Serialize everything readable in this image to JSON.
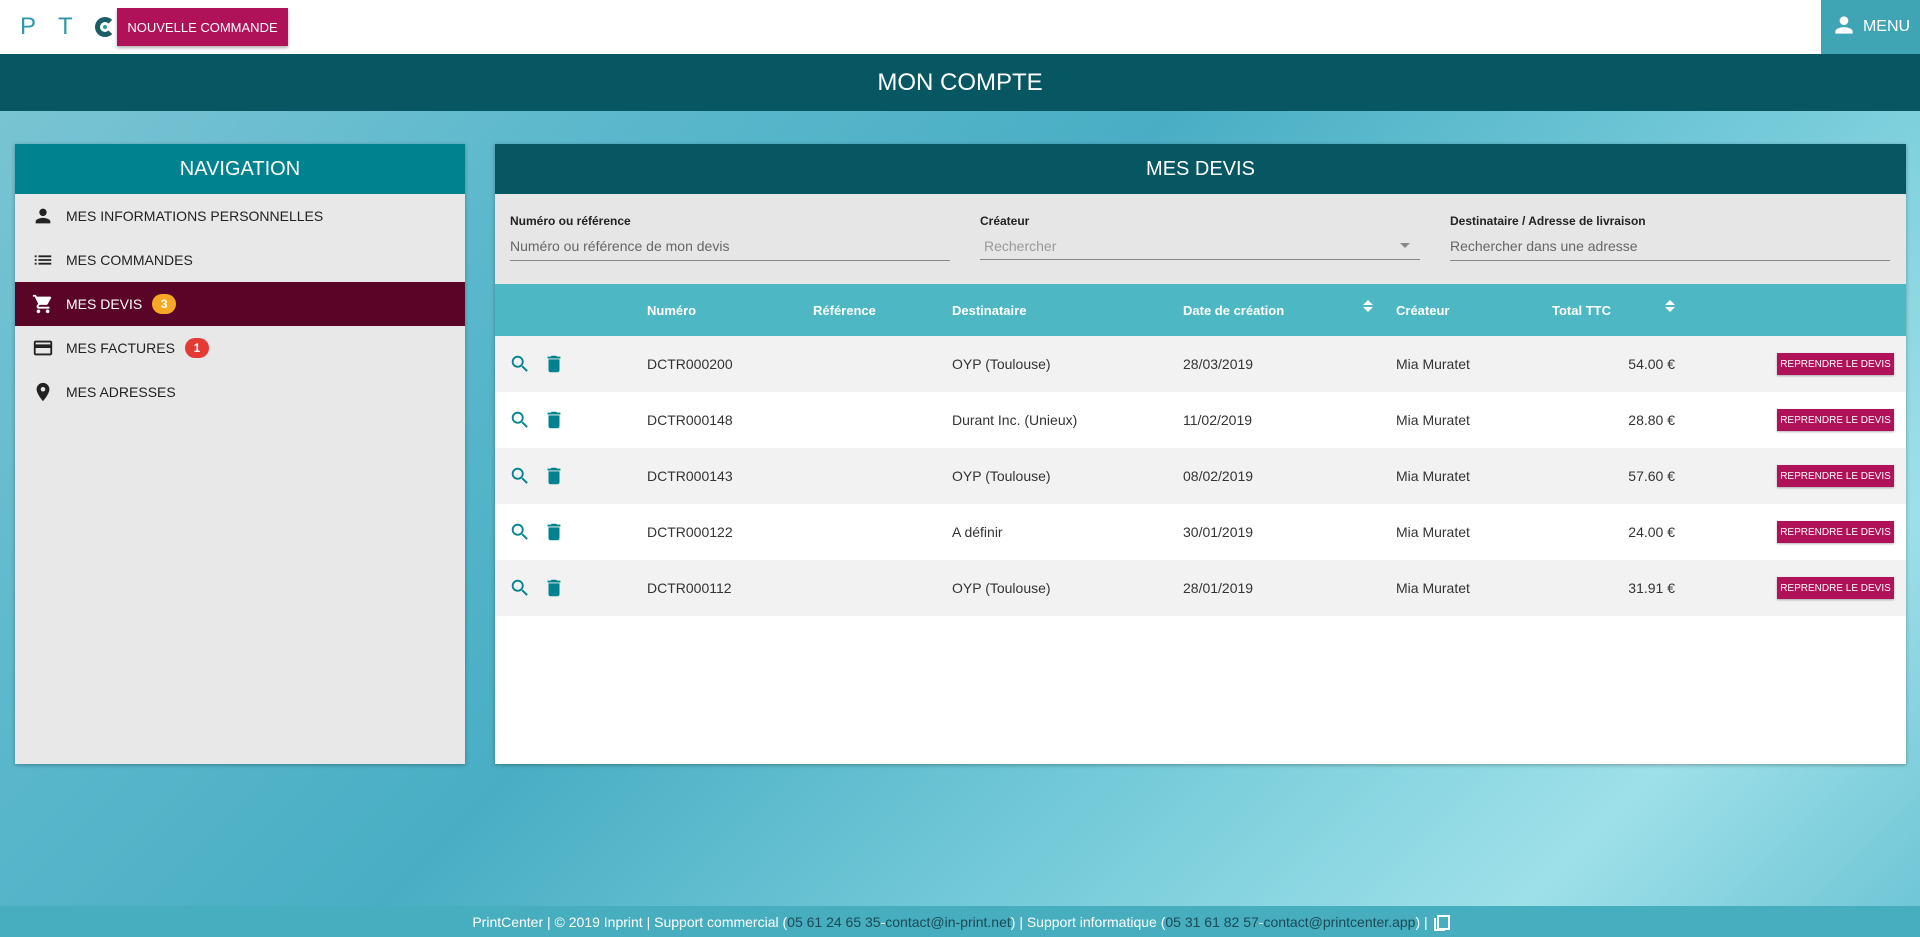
{
  "header": {
    "logo_letters": [
      "P",
      "T"
    ],
    "new_order_label": "NOUVELLE COMMANDE",
    "menu_label": "MENU"
  },
  "page_title": "MON COMPTE",
  "navigation": {
    "title": "NAVIGATION",
    "items": [
      {
        "label": "MES INFORMATIONS PERSONNELLES",
        "icon": "person-icon"
      },
      {
        "label": "MES COMMANDES",
        "icon": "list-icon"
      },
      {
        "label": "MES DEVIS",
        "icon": "cart-icon",
        "badge": "3",
        "active": true
      },
      {
        "label": "MES FACTURES",
        "icon": "credit-card-icon",
        "badge": "1"
      },
      {
        "label": "MES ADRESSES",
        "icon": "location-pin-icon"
      }
    ]
  },
  "quotes": {
    "title": "MES DEVIS",
    "filters": {
      "number": {
        "label": "Numéro ou référence",
        "placeholder": "Numéro ou référence de mon devis"
      },
      "creator": {
        "label": "Créateur",
        "placeholder": "Rechercher"
      },
      "address": {
        "label": "Destinataire / Adresse de livraison",
        "placeholder": "Rechercher dans une adresse"
      }
    },
    "columns": [
      "Numéro",
      "Référence",
      "Destinataire",
      "Date de création",
      "Créateur",
      "Total TTC"
    ],
    "resume_label": "REPRENDRE LE DEVIS",
    "rows": [
      {
        "numero": "DCTR000200",
        "reference": "",
        "destinataire": "OYP (Toulouse)",
        "date": "28/03/2019",
        "createur": "Mia Muratet",
        "total": "54.00 €"
      },
      {
        "numero": "DCTR000148",
        "reference": "",
        "destinataire": "Durant Inc. (Unieux)",
        "date": "11/02/2019",
        "createur": "Mia Muratet",
        "total": "28.80 €"
      },
      {
        "numero": "DCTR000143",
        "reference": "",
        "destinataire": "OYP (Toulouse)",
        "date": "08/02/2019",
        "createur": "Mia Muratet",
        "total": "57.60 €"
      },
      {
        "numero": "DCTR000122",
        "reference": "",
        "destinataire": "A définir",
        "date": "30/01/2019",
        "createur": "Mia Muratet",
        "total": "24.00 €"
      },
      {
        "numero": "DCTR000112",
        "reference": "",
        "destinataire": "OYP (Toulouse)",
        "date": "28/01/2019",
        "createur": "Mia Muratet",
        "total": "31.91 €"
      }
    ]
  },
  "footer": {
    "prefix": "PrintCenter | © 2019 Inprint | Support commercial (",
    "commercial_phone": "05 61 24 65 35",
    "commercial_sep": " - ",
    "commercial_email": "contact@in-print.net",
    "middle": ") | Support informatique (",
    "it_phone": "05 31 61 82 57",
    "it_sep": " - ",
    "it_email": "contact@printcenter.app",
    "suffix": ") |"
  }
}
